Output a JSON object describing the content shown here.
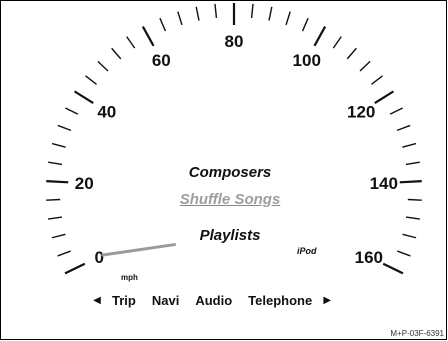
{
  "speedometer": {
    "labels": [
      "0",
      "20",
      "40",
      "60",
      "80",
      "100",
      "120",
      "140",
      "160"
    ],
    "unit": "mph",
    "needle_speed": 0,
    "colors": {
      "needle": "#9a9a9a",
      "ticks": "#111111"
    }
  },
  "menu": {
    "items": [
      "Composers",
      "Shuffle Songs",
      "Playlists"
    ],
    "selected_index": 1,
    "source_label": "iPod"
  },
  "bottom_bar": {
    "left_arrow": "◀",
    "right_arrow": "▶",
    "items": [
      "Trip",
      "Navi",
      "Audio",
      "Telephone"
    ]
  },
  "reference_code": "M+P-03F-6391"
}
